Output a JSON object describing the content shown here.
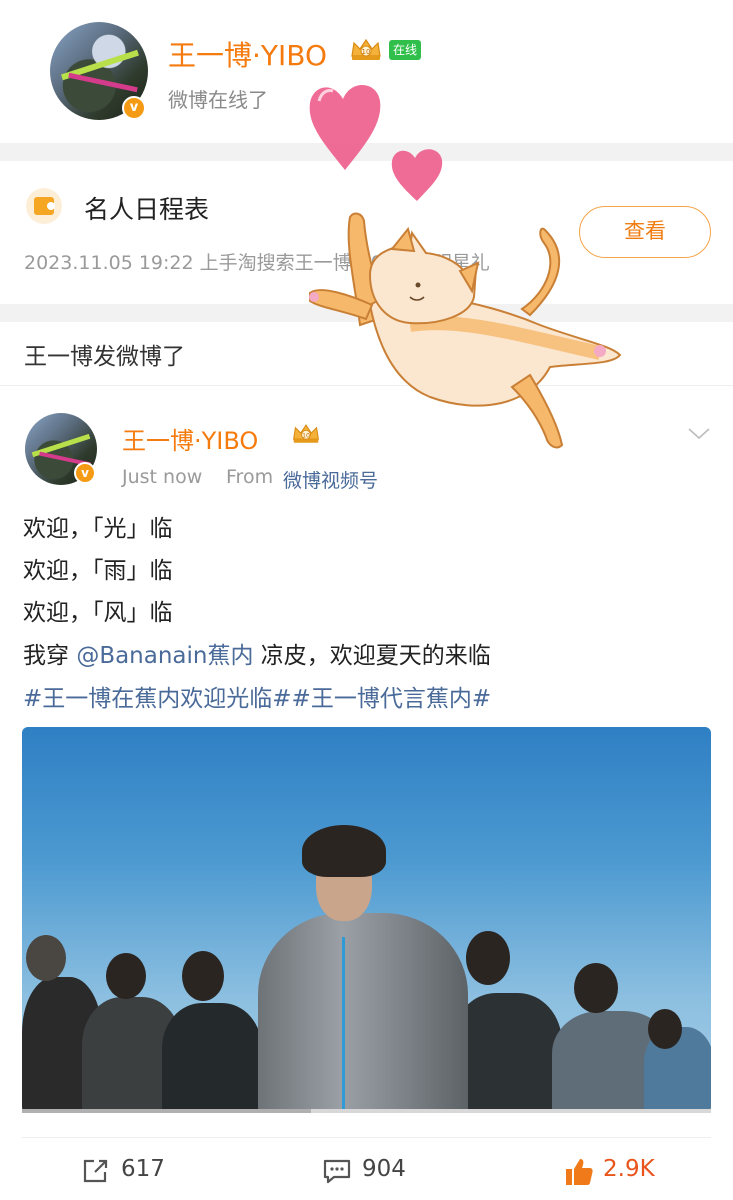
{
  "profile": {
    "name": "王一博·YIBO",
    "online_badge": "在线",
    "status": "微博在线了",
    "verified_mark": "v"
  },
  "schedule": {
    "title": "名人日程表",
    "subtitle": "2023.11.05 19:22 上手淘搜索王一博　01元抽明星礼",
    "button_label": "查看"
  },
  "notice": {
    "text": "王一博发微博了"
  },
  "post": {
    "author": "王一博·YIBO",
    "time": "Just now",
    "from_label": "From",
    "source": "微博视频号",
    "lines": [
      "欢迎，「光」临",
      "欢迎，「雨」临",
      "欢迎，「风」临"
    ],
    "line4_prefix": "我穿 ",
    "line4_mention": "@Bananain蕉内",
    "line4_suffix": " 凉皮，欢迎夏天的来临",
    "hashtags": "#王一博在蕉内欢迎光临##王一博代言蕉内#",
    "video_progress": 0.42
  },
  "actions": {
    "repost_count": "617",
    "comment_count": "904",
    "like_count": "2.9K"
  },
  "colors": {
    "accent_orange": "#f57b0f",
    "link_blue": "#4a6a99",
    "online_green": "#2fbf4a",
    "like_red": "#e8541c"
  },
  "icons": [
    "crown-badge-icon",
    "verified-icon",
    "calendar-star-icon",
    "chevron-down-icon",
    "repost-icon",
    "comment-icon",
    "thumbs-up-icon"
  ]
}
